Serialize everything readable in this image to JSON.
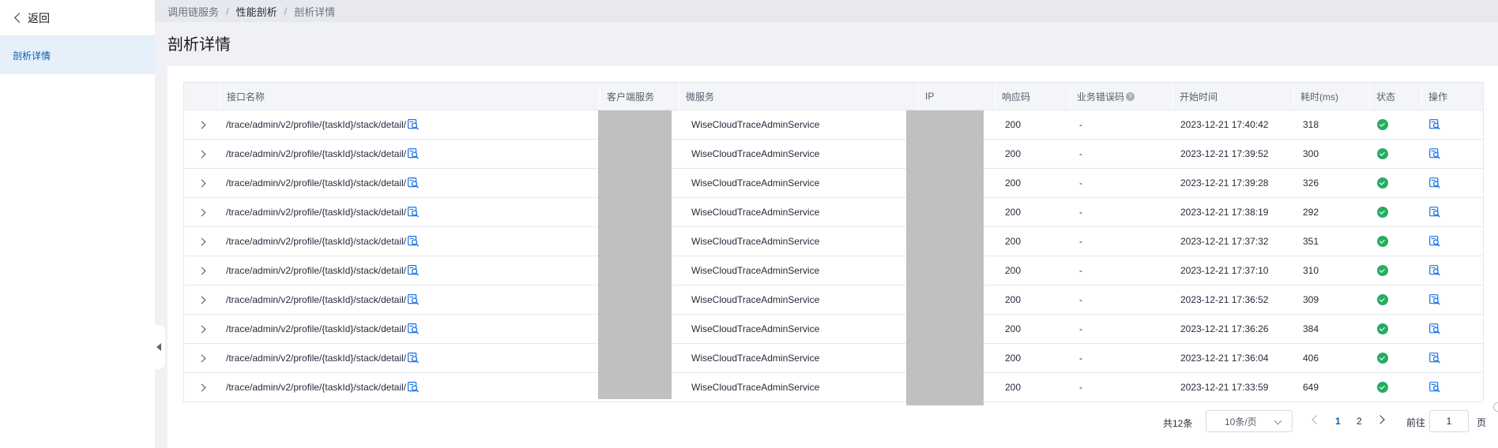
{
  "sidebar": {
    "back_label": "返回",
    "items": [
      {
        "label": "剖析详情",
        "active": true
      }
    ]
  },
  "breadcrumb": {
    "items": [
      "调用链服务",
      "性能剖析",
      "剖析详情"
    ],
    "separator": "/"
  },
  "page_title": "剖析详情",
  "table": {
    "columns": [
      "",
      "接口名称",
      "客户端服务",
      "微服务",
      "IP",
      "响应码",
      "业务错误码",
      "开始时间",
      "耗时(ms)",
      "状态",
      "操作"
    ],
    "help_icon": "?",
    "rows": [
      {
        "name": "/trace/admin/v2/profile/{taskId}/stack/detail/",
        "client": "",
        "service": "WiseCloudTraceAdminService",
        "ip": "",
        "code": "200",
        "biz_code": "-",
        "start": "2023-12-21 17:40:42",
        "cost": "318",
        "status": "success"
      },
      {
        "name": "/trace/admin/v2/profile/{taskId}/stack/detail/",
        "client": "",
        "service": "WiseCloudTraceAdminService",
        "ip": "",
        "code": "200",
        "biz_code": "-",
        "start": "2023-12-21 17:39:52",
        "cost": "300",
        "status": "success"
      },
      {
        "name": "/trace/admin/v2/profile/{taskId}/stack/detail/",
        "client": "",
        "service": "WiseCloudTraceAdminService",
        "ip": "",
        "code": "200",
        "biz_code": "-",
        "start": "2023-12-21 17:39:28",
        "cost": "326",
        "status": "success"
      },
      {
        "name": "/trace/admin/v2/profile/{taskId}/stack/detail/",
        "client": "",
        "service": "WiseCloudTraceAdminService",
        "ip": "",
        "code": "200",
        "biz_code": "-",
        "start": "2023-12-21 17:38:19",
        "cost": "292",
        "status": "success"
      },
      {
        "name": "/trace/admin/v2/profile/{taskId}/stack/detail/",
        "client": "",
        "service": "WiseCloudTraceAdminService",
        "ip": "",
        "code": "200",
        "biz_code": "-",
        "start": "2023-12-21 17:37:32",
        "cost": "351",
        "status": "success"
      },
      {
        "name": "/trace/admin/v2/profile/{taskId}/stack/detail/",
        "client": "",
        "service": "WiseCloudTraceAdminService",
        "ip": "",
        "code": "200",
        "biz_code": "-",
        "start": "2023-12-21 17:37:10",
        "cost": "310",
        "status": "success"
      },
      {
        "name": "/trace/admin/v2/profile/{taskId}/stack/detail/",
        "client": "",
        "service": "WiseCloudTraceAdminService",
        "ip": "",
        "code": "200",
        "biz_code": "-",
        "start": "2023-12-21 17:36:52",
        "cost": "309",
        "status": "success"
      },
      {
        "name": "/trace/admin/v2/profile/{taskId}/stack/detail/",
        "client": "",
        "service": "WiseCloudTraceAdminService",
        "ip": "",
        "code": "200",
        "biz_code": "-",
        "start": "2023-12-21 17:36:26",
        "cost": "384",
        "status": "success"
      },
      {
        "name": "/trace/admin/v2/profile/{taskId}/stack/detail/",
        "client": "",
        "service": "WiseCloudTraceAdminService",
        "ip": "",
        "code": "200",
        "biz_code": "-",
        "start": "2023-12-21 17:36:04",
        "cost": "406",
        "status": "success"
      },
      {
        "name": "/trace/admin/v2/profile/{taskId}/stack/detail/",
        "client": "",
        "service": "WiseCloudTraceAdminService",
        "ip": "",
        "code": "200",
        "biz_code": "-",
        "start": "2023-12-21 17:33:59",
        "cost": "649",
        "status": "success"
      }
    ]
  },
  "pagination": {
    "total": "共12条",
    "page_size": "10条/页",
    "pages": [
      "1",
      "2"
    ],
    "current_page": "1",
    "goto_label": "前往",
    "goto_value": "1",
    "page_unit": "页"
  },
  "colors": {
    "accent": "#0d5aa7",
    "success": "#26ad62",
    "masked": "#c0c0c0",
    "link_icon": "#1a73e8"
  }
}
